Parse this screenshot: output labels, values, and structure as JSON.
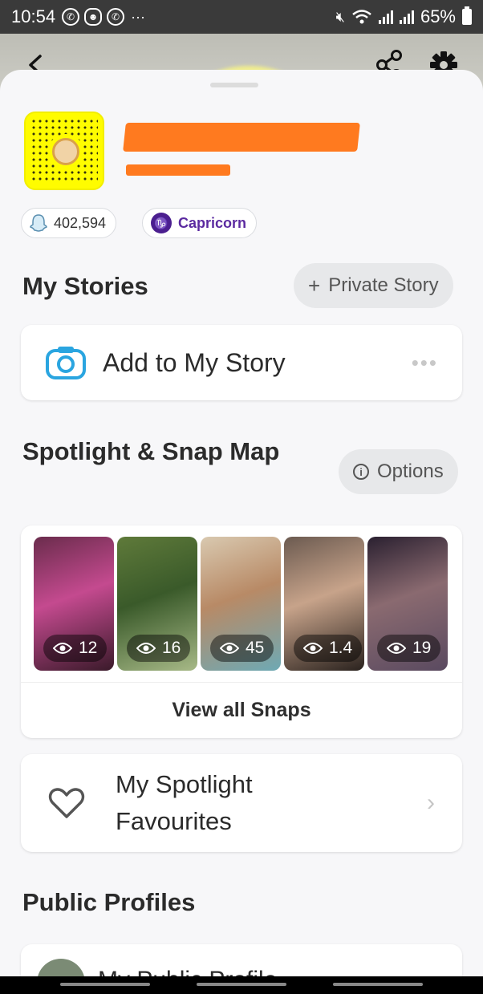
{
  "status_bar": {
    "time": "10:54",
    "battery": "65%",
    "notification_icons": [
      "whatsapp-icon",
      "snapchat-icon",
      "whatsapp-icon"
    ],
    "more": "···"
  },
  "profile": {
    "name_redacted": true,
    "username_redacted": true,
    "snap_score": "402,594",
    "zodiac": "Capricorn",
    "zodiac_glyph": "♑"
  },
  "stories": {
    "title": "My Stories",
    "private_story_label": "Private Story",
    "add_story_label": "Add to My Story"
  },
  "spotlight": {
    "title": "Spotlight & Snap Map",
    "options_label": "Options",
    "thumbnails": [
      {
        "views": "12",
        "colors": [
          "#6a2c4c",
          "#3a1a2a",
          "#c44a8f"
        ]
      },
      {
        "views": "16",
        "colors": [
          "#5f7a3a",
          "#a7b987",
          "#3a5a2a"
        ]
      },
      {
        "views": "45",
        "colors": [
          "#d9c9b0",
          "#6ea9b4",
          "#b88a66"
        ]
      },
      {
        "views": "1.4",
        "colors": [
          "#6b5a50",
          "#2a221e",
          "#c7a38a"
        ]
      },
      {
        "views": "19",
        "colors": [
          "#2a2030",
          "#5a4a60",
          "#8a6a70"
        ]
      }
    ],
    "view_all_label": "View all Snaps"
  },
  "favourites": {
    "line1": "My Spotlight",
    "line2": "Favourites"
  },
  "public_profiles": {
    "title": "Public Profiles",
    "row_label": "My Public Profile"
  },
  "colors": {
    "accent_blue": "#2aa5e0",
    "snap_yellow": "#fffc00",
    "redaction_orange": "#ff7a1f",
    "zodiac_purple": "#4b1f8f"
  }
}
